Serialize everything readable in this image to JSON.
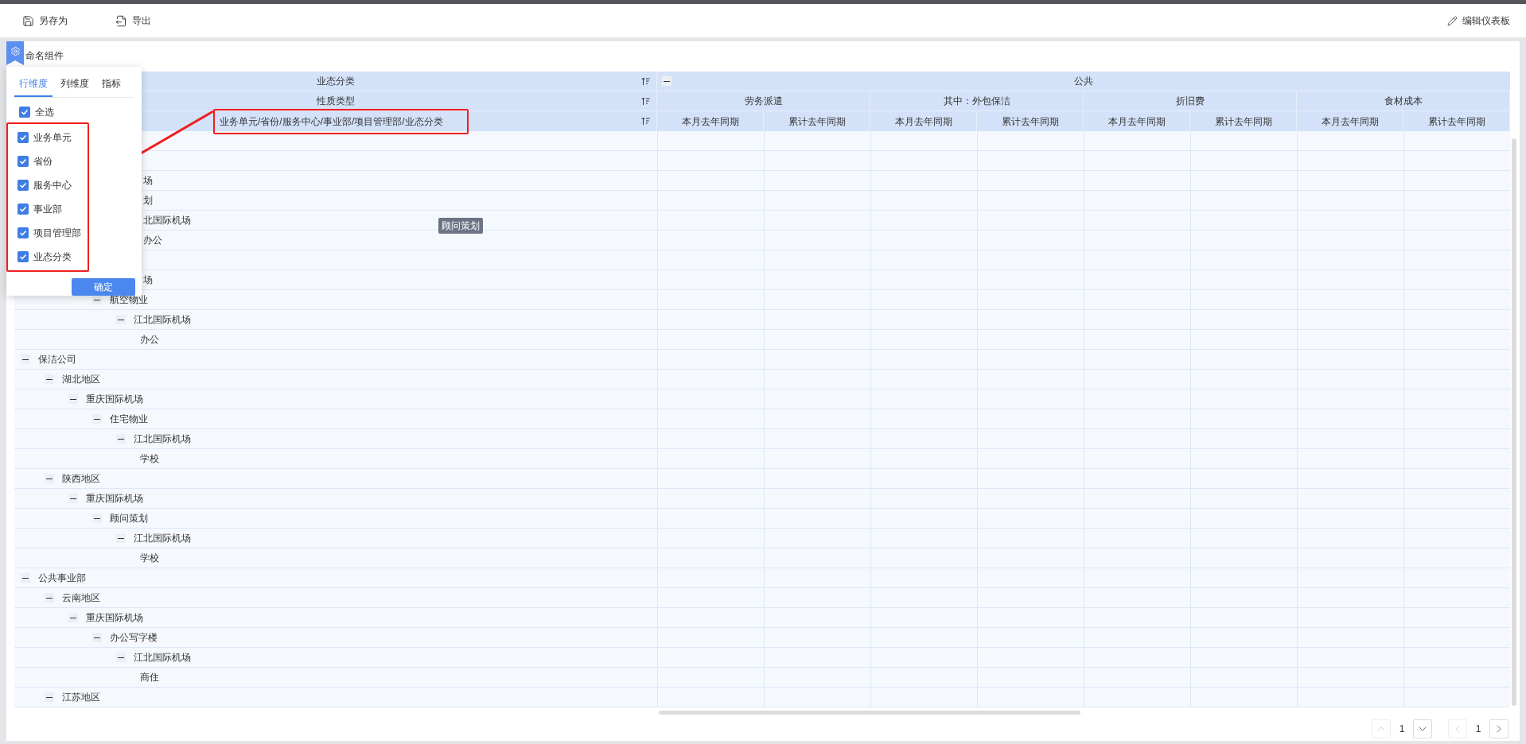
{
  "toolbar": {
    "buttons": [
      {
        "label": "另存为",
        "kind": "save"
      },
      {
        "label": "导出",
        "kind": "export"
      }
    ],
    "edit_button": {
      "label": "编辑仪表板"
    }
  },
  "card": {
    "title": "命名组件"
  },
  "table": {
    "dimension_headers": [
      {
        "label": "业态分类"
      },
      {
        "label": "性质类型"
      },
      {
        "label": "业务单元/省份/服务中心/事业部/项目管理部/业态分类",
        "highlighted": true
      }
    ],
    "top_group": {
      "label": "公共",
      "expanded": true
    },
    "groups": [
      {
        "label": "劳务派遣",
        "columns": [
          "本月去年同期",
          "累计去年同期"
        ]
      },
      {
        "label": "其中：外包保洁",
        "columns": [
          "本月去年同期",
          "累计去年同期"
        ]
      },
      {
        "label": "折旧费",
        "columns": [
          "本月去年同期",
          "累计去年同期"
        ]
      },
      {
        "label": "食材成本",
        "columns": [
          "本月去年同期",
          "累计去年同期"
        ]
      }
    ],
    "rows": [
      {
        "covered": true,
        "children": [
          {
            "covered": true,
            "children": [
              {
                "covered": true,
                "label": "场",
                "children": [
                  {
                    "covered": true,
                    "label": "划",
                    "children": [
                      {
                        "covered": true,
                        "label": "北国际机场",
                        "children": [
                          {
                            "covered": true,
                            "label": "办公"
                          }
                        ]
                      }
                    ]
                  }
                ]
              }
            ]
          },
          {
            "covered": true,
            "children": [
              {
                "covered": true,
                "label": "场",
                "children": [
                  {
                    "label": "航空物业",
                    "expanded": true,
                    "children": [
                      {
                        "label": "江北国际机场",
                        "expanded": true,
                        "children": [
                          {
                            "label": "办公"
                          }
                        ]
                      }
                    ]
                  }
                ]
              }
            ]
          }
        ]
      },
      {
        "label": "保洁公司",
        "expanded": true,
        "children": [
          {
            "label": "湖北地区",
            "expanded": true,
            "children": [
              {
                "label": "重庆国际机场",
                "expanded": true,
                "children": [
                  {
                    "label": "住宅物业",
                    "expanded": true,
                    "children": [
                      {
                        "label": "江北国际机场",
                        "expanded": true,
                        "children": [
                          {
                            "label": "学校"
                          }
                        ]
                      }
                    ]
                  }
                ]
              }
            ]
          },
          {
            "label": "陕西地区",
            "expanded": true,
            "children": [
              {
                "label": "重庆国际机场",
                "expanded": true,
                "children": [
                  {
                    "label": "顾问策划",
                    "expanded": true,
                    "children": [
                      {
                        "label": "江北国际机场",
                        "expanded": true,
                        "children": [
                          {
                            "label": "学校"
                          }
                        ]
                      }
                    ]
                  }
                ]
              }
            ]
          }
        ]
      },
      {
        "label": "公共事业部",
        "expanded": true,
        "children": [
          {
            "label": "云南地区",
            "expanded": true,
            "children": [
              {
                "label": "重庆国际机场",
                "expanded": true,
                "children": [
                  {
                    "label": "办公写字楼",
                    "expanded": true,
                    "children": [
                      {
                        "label": "江北国际机场",
                        "expanded": true,
                        "children": [
                          {
                            "label": "商住"
                          }
                        ]
                      }
                    ]
                  }
                ]
              }
            ]
          },
          {
            "label": "江苏地区",
            "expanded": true
          }
        ]
      }
    ]
  },
  "tooltip": "顾问策划",
  "popup": {
    "tabs": [
      {
        "label": "行维度",
        "selected": true
      },
      {
        "label": "列维度",
        "selected": false
      },
      {
        "label": "指标",
        "selected": false
      }
    ],
    "select_all": {
      "label": "全选",
      "checked": true
    },
    "items": [
      {
        "label": "业务单元",
        "checked": true
      },
      {
        "label": "省份",
        "checked": true
      },
      {
        "label": "服务中心",
        "checked": true
      },
      {
        "label": "事业部",
        "checked": true
      },
      {
        "label": "项目管理部",
        "checked": true
      },
      {
        "label": "业态分类",
        "checked": true
      }
    ],
    "confirm": "确定"
  },
  "pagination": {
    "row_page": "1",
    "col_page": "1",
    "up_disabled": true,
    "down_disabled": false,
    "prev_disabled": true,
    "next_disabled": false
  }
}
